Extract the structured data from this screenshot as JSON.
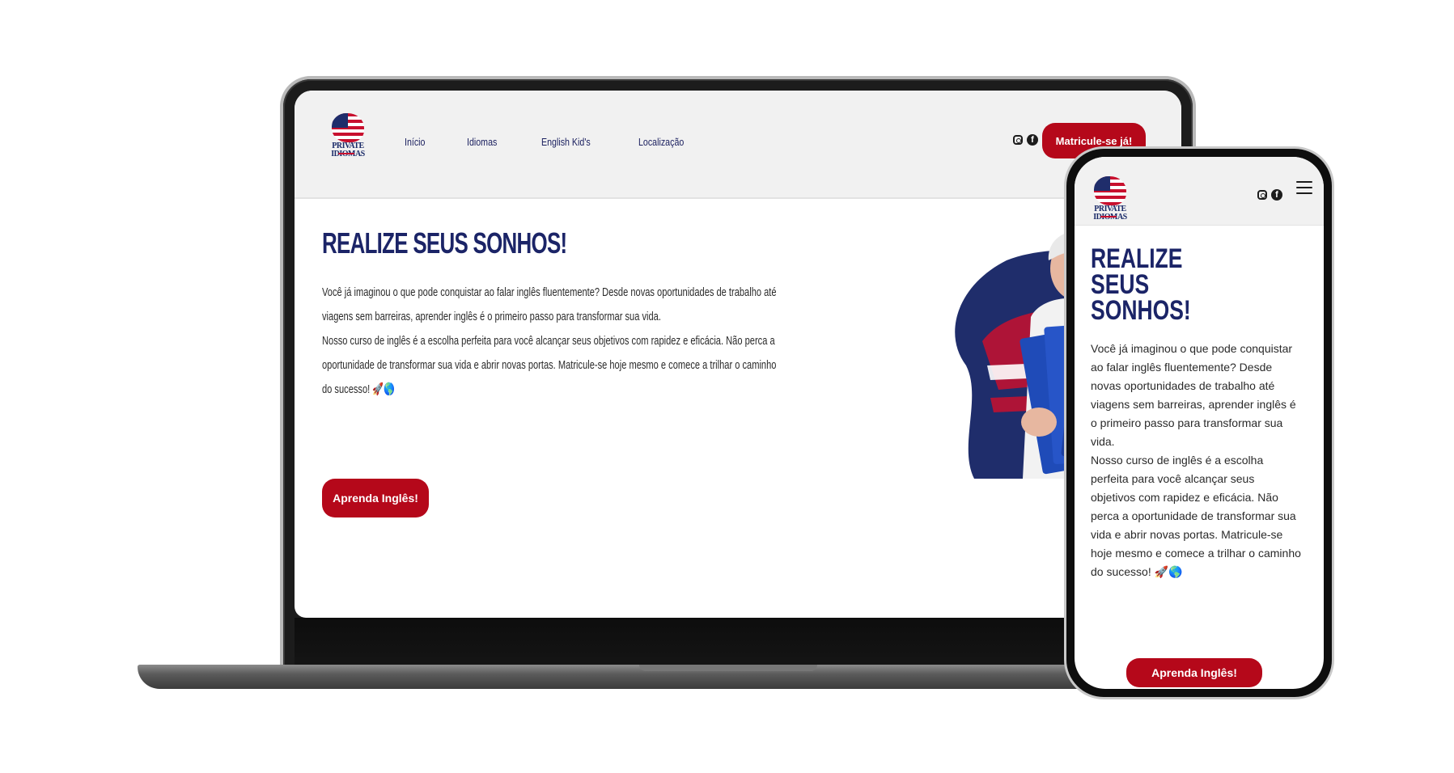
{
  "site": {
    "brand": "PRIVATE IDIOMAS",
    "nav": [
      "Início",
      "Idiomas",
      "English Kid's",
      "Localização"
    ],
    "cta": "Matricule-se já!",
    "social_icons": [
      "instagram-icon",
      "facebook-icon"
    ],
    "hero": {
      "title": "REALIZE SEUS SONHOS!",
      "paragraph_1": "Você já imaginou o que pode conquistar ao falar inglês fluentemente? Desde novas oportunidades de trabalho até viagens sem barreiras, aprender inglês é o primeiro passo para transformar sua vida.",
      "paragraph_2": "Nosso curso de inglês é a escolha perfeita para você alcançar seus objetivos com rapidez e eficácia. Não perca a oportunidade de transformar sua vida e abrir novas portas. Matricule-se hoje mesmo e comece a trilhar o caminho do sucesso! 🚀🌎",
      "button": "Aprenda Inglês!"
    }
  },
  "colors": {
    "accent_red": "#b5081a",
    "title_navy": "#1b2467",
    "header_bg": "#f1f1f1"
  }
}
